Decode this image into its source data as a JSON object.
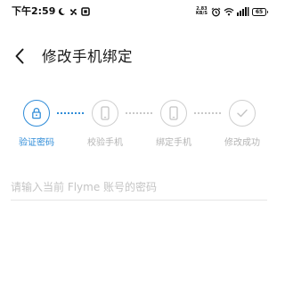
{
  "status_bar": {
    "time": "下午2:59",
    "net_speed_value": "2.83",
    "net_speed_unit": "KB/S",
    "battery": "65"
  },
  "header": {
    "title": "修改手机绑定"
  },
  "stepper": {
    "accent_color": "#2f8cd8",
    "steps": [
      {
        "label": "验证密码",
        "icon": "lock-icon",
        "state": "active"
      },
      {
        "label": "校验手机",
        "icon": "phone-icon",
        "state": "inactive"
      },
      {
        "label": "绑定手机",
        "icon": "phone-icon",
        "state": "inactive"
      },
      {
        "label": "修改成功",
        "icon": "check-icon",
        "state": "inactive"
      }
    ]
  },
  "form": {
    "password_placeholder": "请输入当前 Flyme 账号的密码",
    "password_value": ""
  }
}
